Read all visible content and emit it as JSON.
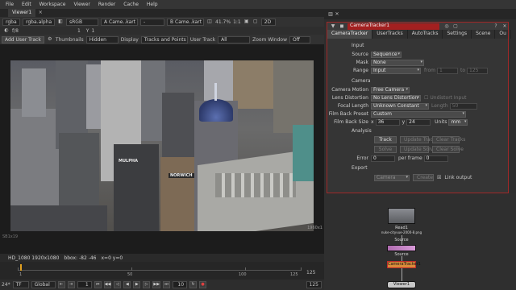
{
  "menubar": {
    "items": [
      "File",
      "Edit",
      "Workspace",
      "Viewer",
      "Render",
      "Cache",
      "Help"
    ]
  },
  "viewer": {
    "tab_label": "Viewer1",
    "toolbar1": {
      "channels": "rgba",
      "layer": "rgba.alpha",
      "colorspace": "sRGB",
      "a_input": "A  Came..kart",
      "a_op": "-",
      "b_input": "B  Came..kart",
      "zoom": "41.7%",
      "zoom_ratio": "1:1",
      "view_mode": "2D"
    },
    "toolbar2": {
      "f_label": "f/8",
      "f_value": "1",
      "y_label": "Y",
      "y_value": "1"
    },
    "toolbar3": {
      "add_user_track": "Add User Track",
      "thumbnails_label": "Thumbnails",
      "thumbnails_value": "Hidden",
      "display_label": "Display",
      "display_value": "Tracks and Points",
      "user_track_label": "User Track",
      "user_track_value": "All",
      "zoom_window_label": "Zoom Window",
      "zoom_window_value": "Off"
    },
    "image_labels": {
      "sign1": "MULPHA",
      "sign2": "NORWICH"
    },
    "bbox_text": "SB1x19",
    "res_text": "1960x1",
    "status": {
      "format": "HD_1080 1920x1080",
      "bbox": "bbox: -82 -46",
      "xy": "x=0 y=0"
    },
    "timeline": {
      "ticks": [
        "1",
        "50",
        "100",
        "125"
      ],
      "end_frame": "125"
    },
    "transport": {
      "fps": "24*",
      "tf": "TF",
      "scope": "Global",
      "frame": "1",
      "step": "10",
      "end": "125"
    }
  },
  "properties": {
    "node_name": "CameraTracker1",
    "tabs": [
      "CameraTracker",
      "UserTracks",
      "AutoTracks",
      "Settings",
      "Scene",
      "Ou"
    ],
    "input_section": "Input",
    "source_label": "Source",
    "source_value": "Sequence",
    "mask_label": "Mask",
    "mask_value": "None",
    "range_label": "Range",
    "range_value": "Input",
    "range_from_label": "from",
    "range_from": "1",
    "range_to_label": "to",
    "range_to": "125",
    "camera_section": "Camera",
    "camera_motion_label": "Camera Motion",
    "camera_motion_value": "Free Camera",
    "lens_distortion_label": "Lens Distortion",
    "lens_distortion_value": "No Lens Distortion",
    "undistort_input_label": "Undistort Input",
    "focal_length_label": "Focal Length",
    "focal_length_value": "Unknown Constant",
    "length_label": "Length",
    "length_value": "50",
    "film_back_preset_label": "Film Back Preset",
    "film_back_preset_value": "Custom",
    "film_back_size_label": "Film Back Size",
    "film_back_x_label": "x",
    "film_back_x": "36",
    "film_back_y_label": "y",
    "film_back_y": "24",
    "units_label": "Units",
    "units_value": "mm",
    "analysis_section": "Analysis",
    "track_btn": "Track",
    "update_track_btn": "Update Track",
    "clear_tracks_btn": "Clear Tracks",
    "solve_btn": "Solve",
    "update_solve_btn": "Update Solve",
    "clear_solve_btn": "Clear Solve",
    "error_label": "Error",
    "error_value": "0",
    "per_frame_label": "per frame",
    "per_frame_value": "0",
    "export_section": "Export",
    "export_value": "Camera",
    "create_btn": "Create",
    "link_output_label": "Link output"
  },
  "nodegraph": {
    "read_label": "Read1",
    "read_file": "nuke-cityvue-2000-8.png",
    "source_label": "Source",
    "node2_label": "Source",
    "tracker_label": "CameraTracker1",
    "viewer_label": "Viewer1"
  }
}
